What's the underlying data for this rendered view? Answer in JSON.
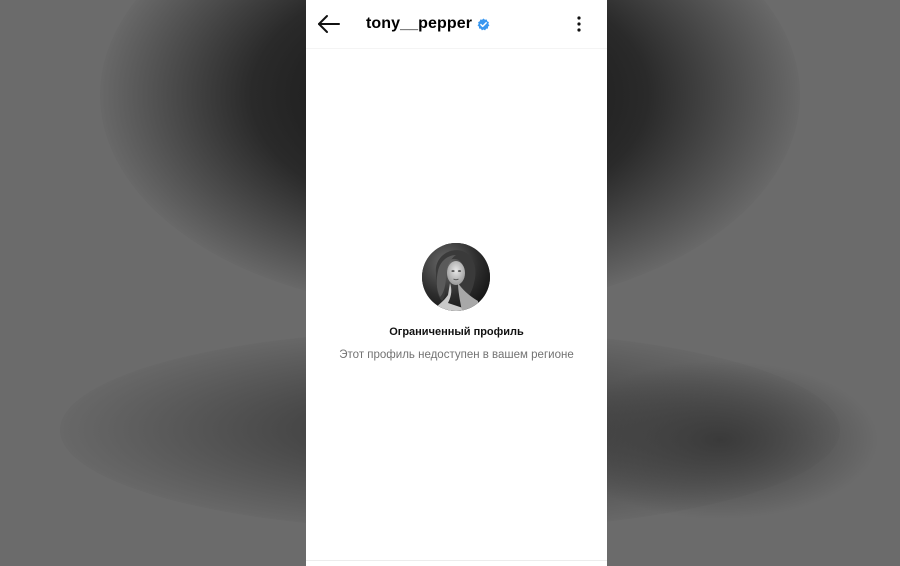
{
  "header": {
    "username": "tony__pepper",
    "verified": true,
    "verified_color": "#3897f0",
    "back_icon": "arrow-left-icon",
    "menu_icon": "more-vertical-icon"
  },
  "profile": {
    "avatar": "profile-photo",
    "title": "Ограниченный профиль",
    "message": "Этот профиль недоступен в вашем регионе"
  }
}
